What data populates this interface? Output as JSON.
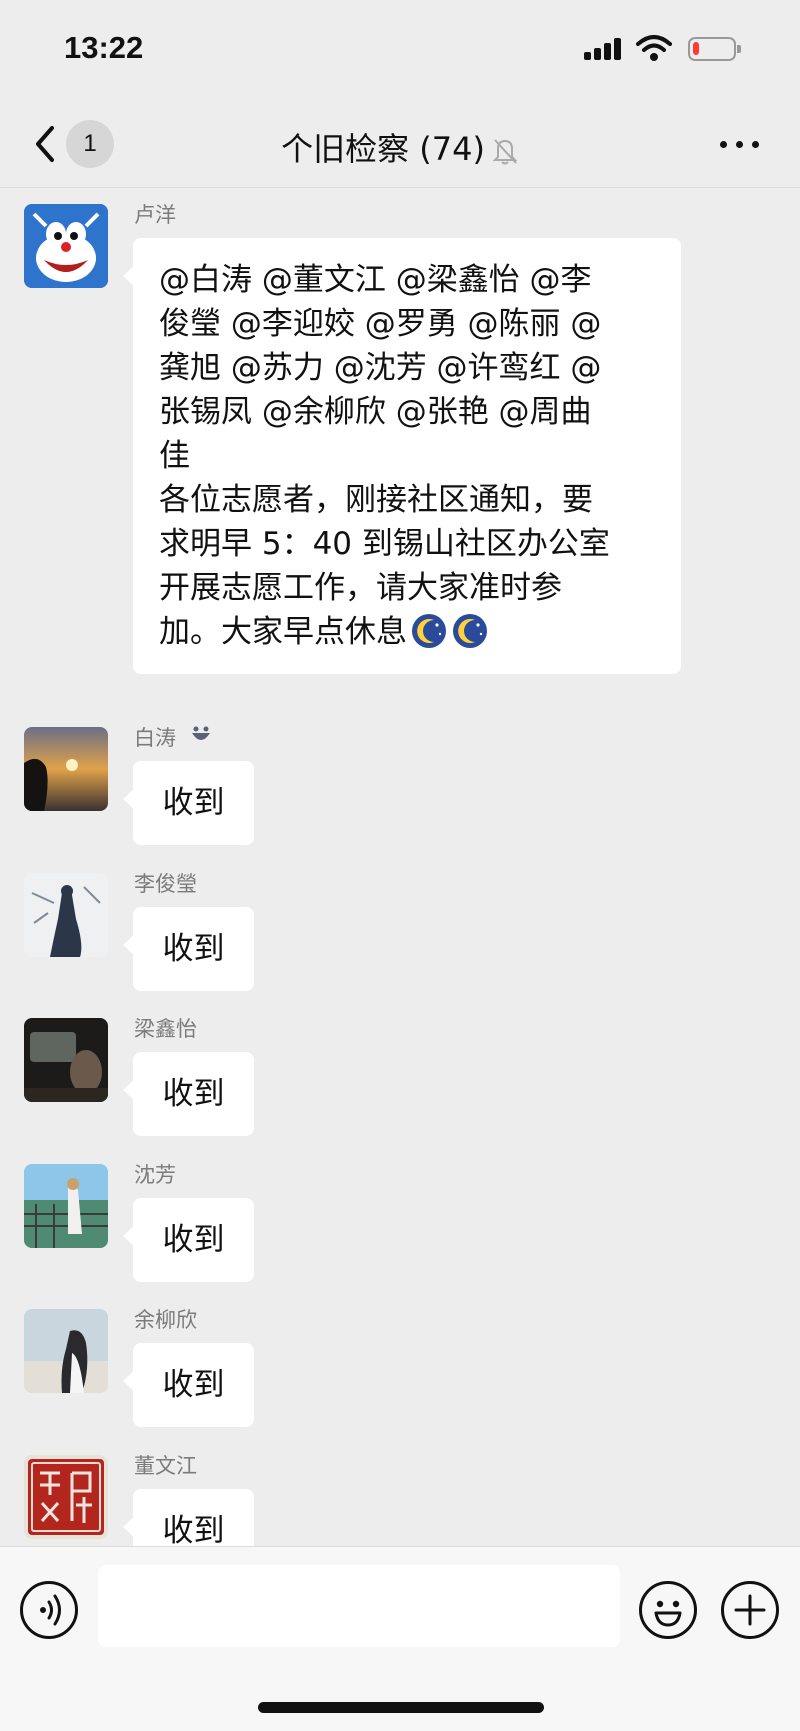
{
  "status_bar": {
    "time": "13:22",
    "battery_level": 0.15,
    "icons": [
      "cellular-signal-icon",
      "wifi-icon",
      "battery-low-icon"
    ]
  },
  "nav": {
    "back_icon": "chevron-left-icon",
    "unread_count": "1",
    "title": "个旧检察 (74)",
    "mute_icon": "bell-slash-icon",
    "more_icon": "ellipsis-icon"
  },
  "messages": [
    {
      "sender": "卢洋",
      "text": "@白涛 @董文江 @梁鑫怡 @李\n俊瑩 @李迎姣 @罗勇 @陈丽 @\n龚旭 @苏力 @沈芳 @许鸾红 @\n张锡凤 @余柳欣 @张艳 @周曲\n佳\n各位志愿者，刚接社区通知，要\n求明早 5：40 到锡山社区办公室\n开展志愿工作，请大家准时参\n加。大家早点休息",
      "emoji": [
        "crescent-moon-emoji",
        "crescent-moon-emoji"
      ]
    },
    {
      "sender": "白涛",
      "text": "收到",
      "sender_tag_icon": "mini-program-icon"
    },
    {
      "sender": "李俊瑩",
      "text": "收到"
    },
    {
      "sender": "梁鑫怡",
      "text": "收到"
    },
    {
      "sender": "沈芳",
      "text": "收到"
    },
    {
      "sender": "余柳欣",
      "text": "收到"
    },
    {
      "sender": "董文江",
      "text": "收到"
    }
  ],
  "input_bar": {
    "voice_icon": "voice-icon",
    "input_value": "",
    "emoji_icon": "smiley-icon",
    "plus_icon": "plus-icon"
  },
  "colors": {
    "background": "#ededed",
    "bubble": "#ffffff",
    "sender_name": "#7b7b7b",
    "input_bar": "#f7f7f7",
    "battery_low": "#ff3b30"
  }
}
